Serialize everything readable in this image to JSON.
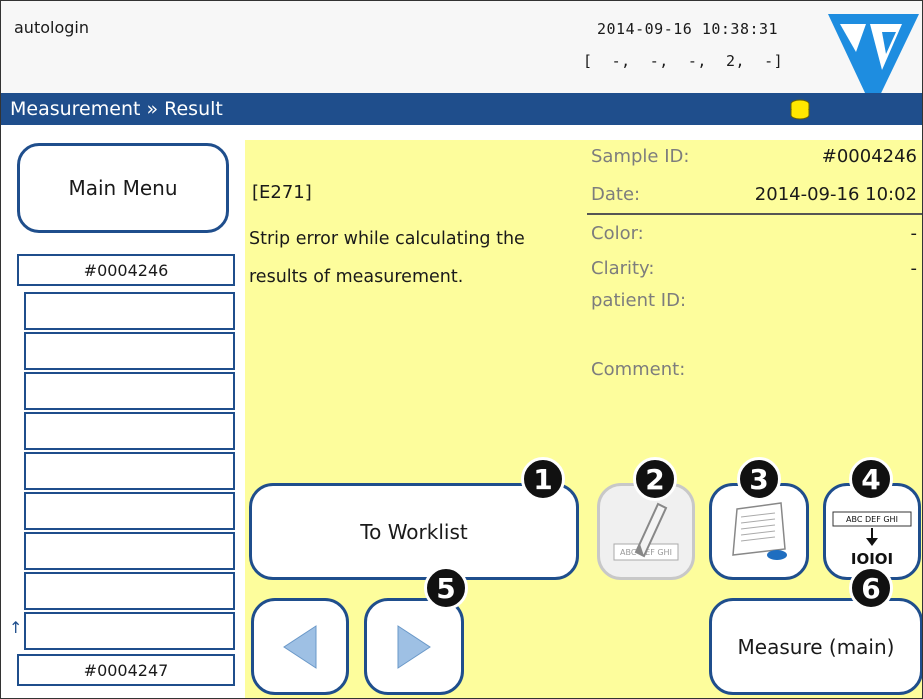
{
  "header": {
    "user": "autologin",
    "datetime": "2014-09-16 10:38:31",
    "status_bracket": "[  -,  -,  -,  2,  -]"
  },
  "titlebar": {
    "breadcrumb": "Measurement » Result"
  },
  "sidebar": {
    "main_menu_label": "Main Menu",
    "current_sample": "#0004246",
    "next_sample": "#0004247"
  },
  "error": {
    "code": "[E271]",
    "message_line1": "Strip error while calculating the",
    "message_line2": "results of measurement."
  },
  "details": {
    "sample_id_label": "Sample ID:",
    "sample_id_value": "#0004246",
    "date_label": "Date:",
    "date_value": "2014-09-16 10:02",
    "color_label": "Color:",
    "color_value": "-",
    "clarity_label": "Clarity:",
    "clarity_value": "-",
    "patient_id_label": "patient ID:",
    "comment_label": "Comment:"
  },
  "buttons": {
    "to_worklist": "To Worklist",
    "measure_main": "Measure (main)",
    "edit_icon_text": "ABC DEF GHI",
    "convert_icon_top": "ABC DEF GHI",
    "convert_icon_bottom": "IOIOI"
  },
  "badges": [
    "1",
    "2",
    "3",
    "4",
    "5",
    "6"
  ],
  "colors": {
    "accent": "#1f4e8c",
    "content_bg": "#fdfd9c",
    "logo": "#1e8de0"
  }
}
